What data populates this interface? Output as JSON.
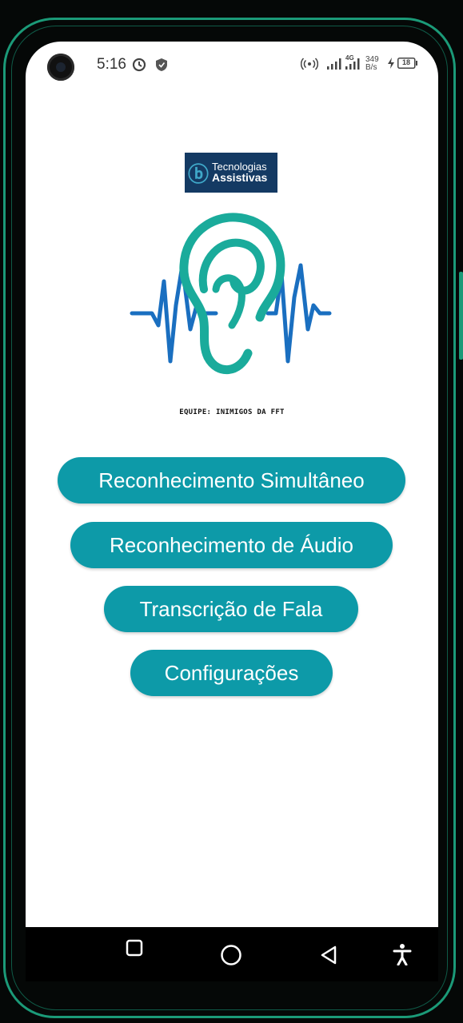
{
  "status_bar": {
    "time": "5:16",
    "data_speed": "349",
    "data_unit": "B/s",
    "network": "4G",
    "battery": "18"
  },
  "logo": {
    "line1": "Tecnologias",
    "line2": "Assistivas"
  },
  "team_label": "EQUIPE: INIMIGOS DA FFT",
  "menu": {
    "simultaneous": "Reconhecimento Simultâneo",
    "audio": "Reconhecimento de Áudio",
    "transcription": "Transcrição de Fala",
    "settings": "Configurações"
  },
  "colors": {
    "accent": "#0d9aa8",
    "ear": "#1aab9b",
    "wave": "#1a6fc0"
  },
  "nav_icons": [
    "recents-icon",
    "home-icon",
    "back-icon",
    "accessibility-icon"
  ]
}
